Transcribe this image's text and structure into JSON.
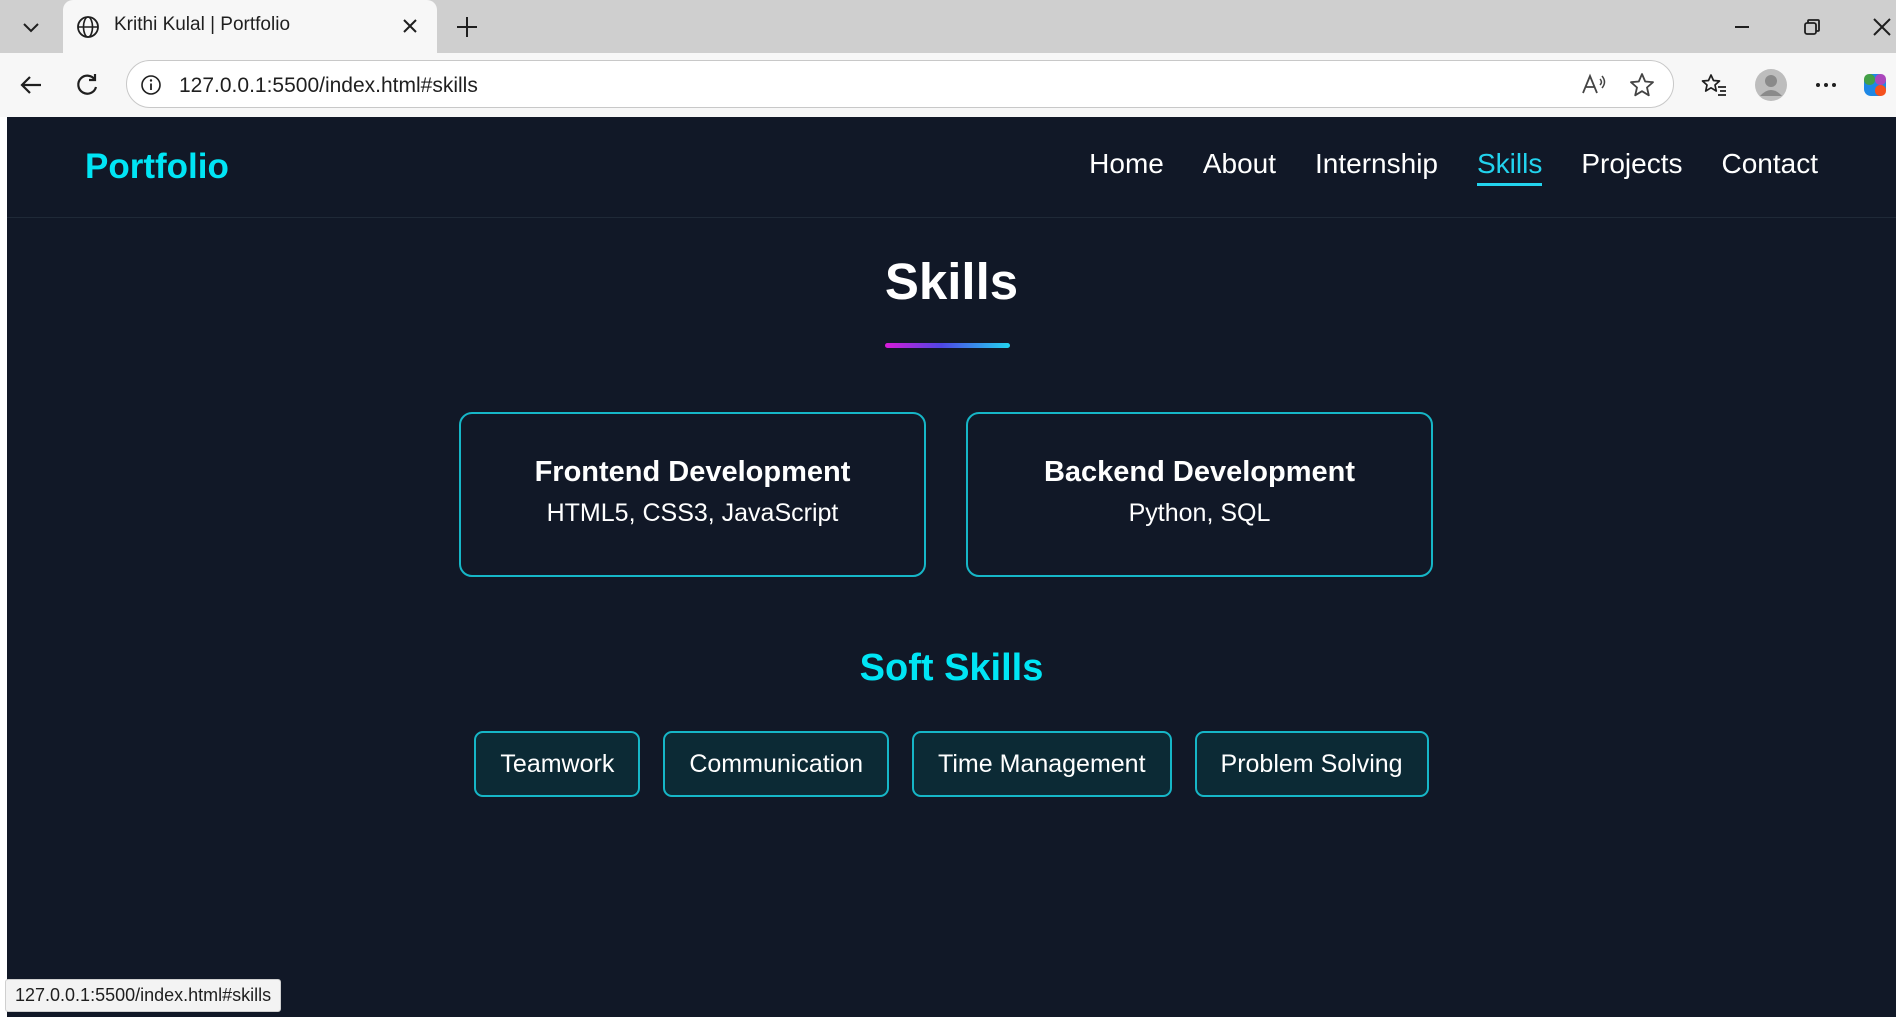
{
  "browser": {
    "tab_title": "Krithi Kulal | Portfolio",
    "url": "127.0.0.1:5500/index.html#skills",
    "status_url": "127.0.0.1:5500/index.html#skills"
  },
  "header": {
    "logo": "Portfolio",
    "nav": [
      "Home",
      "About",
      "Internship",
      "Skills",
      "Projects",
      "Contact"
    ],
    "active_nav": "Skills"
  },
  "skills": {
    "title": "Skills",
    "cards": [
      {
        "title": "Frontend Development",
        "desc": "HTML5, CSS3, JavaScript"
      },
      {
        "title": "Backend Development",
        "desc": "Python, SQL"
      }
    ],
    "soft_title": "Soft Skills",
    "soft_skills": [
      "Teamwork",
      "Communication",
      "Time Management",
      "Problem Solving"
    ]
  },
  "colors": {
    "page_bg": "#111827",
    "accent": "#00e5f5",
    "card_border": "#16b6c7",
    "chip_bg": "#0c2a35"
  }
}
